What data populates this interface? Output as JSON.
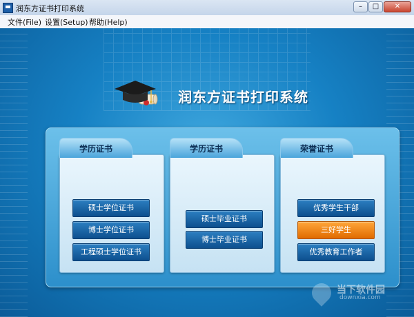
{
  "window": {
    "title": "润东方证书打印系统",
    "min_glyph": "–",
    "max_glyph": "□",
    "close_glyph": "✕"
  },
  "menu": {
    "items": [
      "文件(File)",
      "设置(Setup)",
      "帮助(Help)"
    ]
  },
  "header": {
    "title": "润东方证书打印系统",
    "icon": "graduation-cap-icon"
  },
  "cards": [
    {
      "tab": "学历证书",
      "buttons": [
        "硕士学位证书",
        "博士学位证书",
        "工程硕士学位证书"
      ]
    },
    {
      "tab": "学历证书",
      "buttons": [
        "硕士毕业证书",
        "博士毕业证书"
      ]
    },
    {
      "tab": "荣誉证书",
      "buttons": [
        "优秀学生干部",
        "三好学生",
        "优秀教育工作者"
      ]
    }
  ],
  "active_button": "三好学生",
  "watermark": {
    "text": "当下软件园",
    "sub": "downxia.com"
  },
  "colors": {
    "accent_orange": "#e06b00",
    "button_blue": "#0d4f8e",
    "background_blue": "#1681c4"
  }
}
